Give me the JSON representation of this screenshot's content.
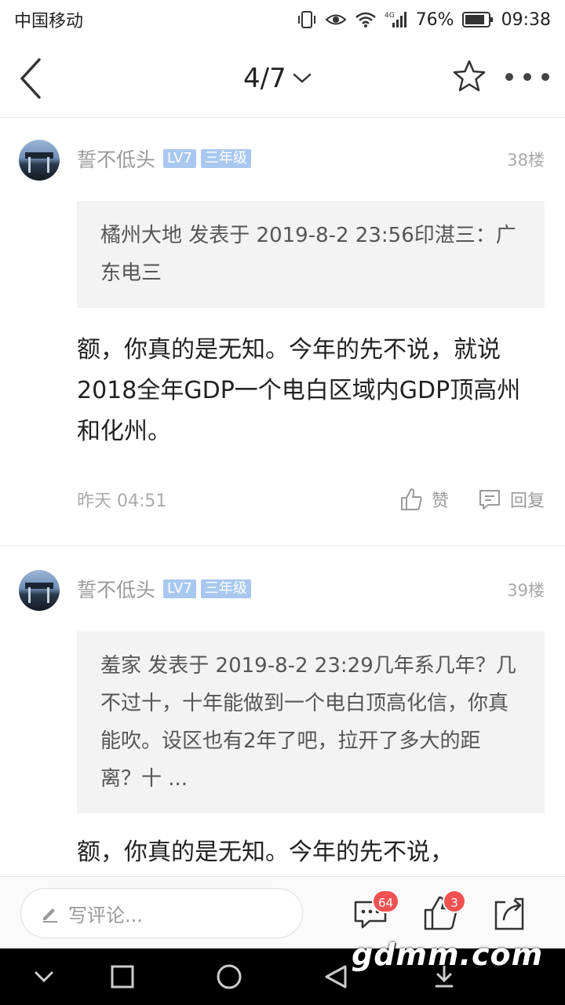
{
  "status_bar": {
    "carrier": "中国移动",
    "battery": "76%",
    "time": "09:38",
    "network": "4G"
  },
  "nav": {
    "pager": "4/7"
  },
  "posts": [
    {
      "username": "誓不低头",
      "level": "LV7",
      "grade": "三年级",
      "floor": "38楼",
      "quote": "橘州大地 发表于 2019-8-2 23:56印湛三：广东电三",
      "content": "额，你真的是无知。今年的先不说，就说2018全年GDP一个电白区域内GDP顶高州和化州。",
      "time": "昨天 04:51",
      "like_label": "赞",
      "reply_label": "回复"
    },
    {
      "username": "誓不低头",
      "level": "LV7",
      "grade": "三年级",
      "floor": "39楼",
      "quote": "羞家 发表于 2019-8-2 23:29几年系几年？几不过十，十年能做到一个电白顶高化信，你真能吹。设区也有2年了吧，拉开了多大的距离？十 ...",
      "content": "额，你真的是无知。今年的先不说，"
    }
  ],
  "bottom_bar": {
    "placeholder": "写评论...",
    "comment_count": "64",
    "like_count": "3"
  },
  "watermark": "gdmm.com",
  "colors": {
    "badge_bg": "#a9c8ef",
    "count_badge": "#f25151",
    "quote_bg": "#f3f3f3"
  }
}
